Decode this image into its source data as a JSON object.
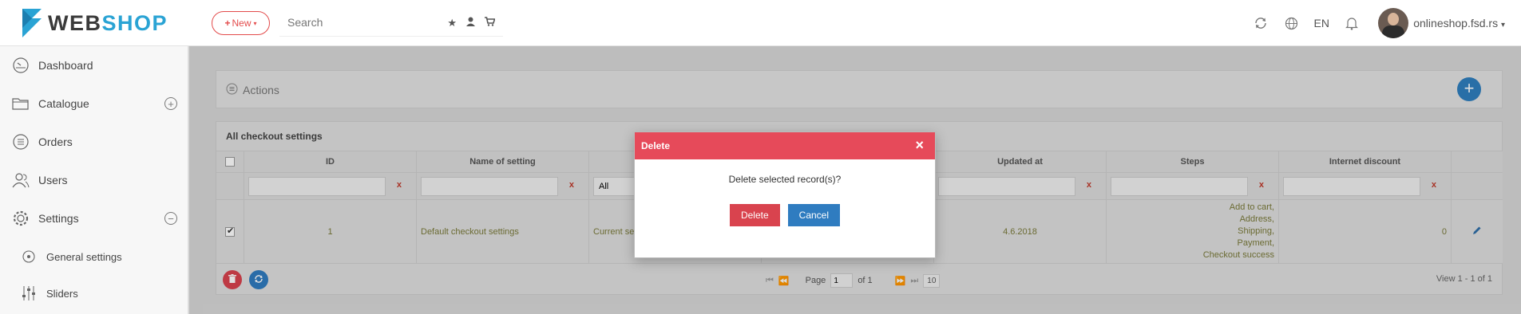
{
  "brand": {
    "web": "WEB",
    "shop": "SHOP"
  },
  "header": {
    "new_label": "New",
    "search_placeholder": "Search",
    "language": "EN",
    "user": "onlineshop.fsd.rs"
  },
  "sidebar": {
    "items": [
      {
        "label": "Dashboard",
        "icon": "dashboard-icon"
      },
      {
        "label": "Catalogue",
        "icon": "folder-icon",
        "expand": "+"
      },
      {
        "label": "Orders",
        "icon": "list-icon"
      },
      {
        "label": "Users",
        "icon": "users-icon"
      },
      {
        "label": "Settings",
        "icon": "gear-icon",
        "expand": "−"
      },
      {
        "label": "General settings",
        "icon": "target-icon"
      },
      {
        "label": "Sliders",
        "icon": "sliders-icon"
      }
    ]
  },
  "actions": {
    "label": "Actions",
    "add": "+"
  },
  "grid": {
    "title": "All checkout settings",
    "columns": [
      "ID",
      "Name of setting",
      "",
      "",
      "Updated at",
      "Steps",
      "Internet discount"
    ],
    "filter_select_value": "All",
    "filter_clear": "x",
    "row": {
      "checked": true,
      "id": "1",
      "name": "Default checkout settings",
      "type": "Current se",
      "updated": "4.6.2018",
      "steps": [
        "Add to cart,",
        "Address,",
        "Shipping,",
        "Payment,",
        "Checkout success"
      ],
      "discount": "0"
    },
    "pager": {
      "page_label": "Page",
      "page_value": "1",
      "of_label": "of 1",
      "per_page": "10",
      "view": "View 1 - 1 of 1"
    }
  },
  "modal": {
    "title": "Delete",
    "message": "Delete selected record(s)?",
    "delete_label": "Delete",
    "cancel_label": "Cancel"
  },
  "colors": {
    "accent_red": "#e64a5a",
    "accent_blue": "#2f7cc0",
    "brand_blue": "#2aa3d4"
  }
}
